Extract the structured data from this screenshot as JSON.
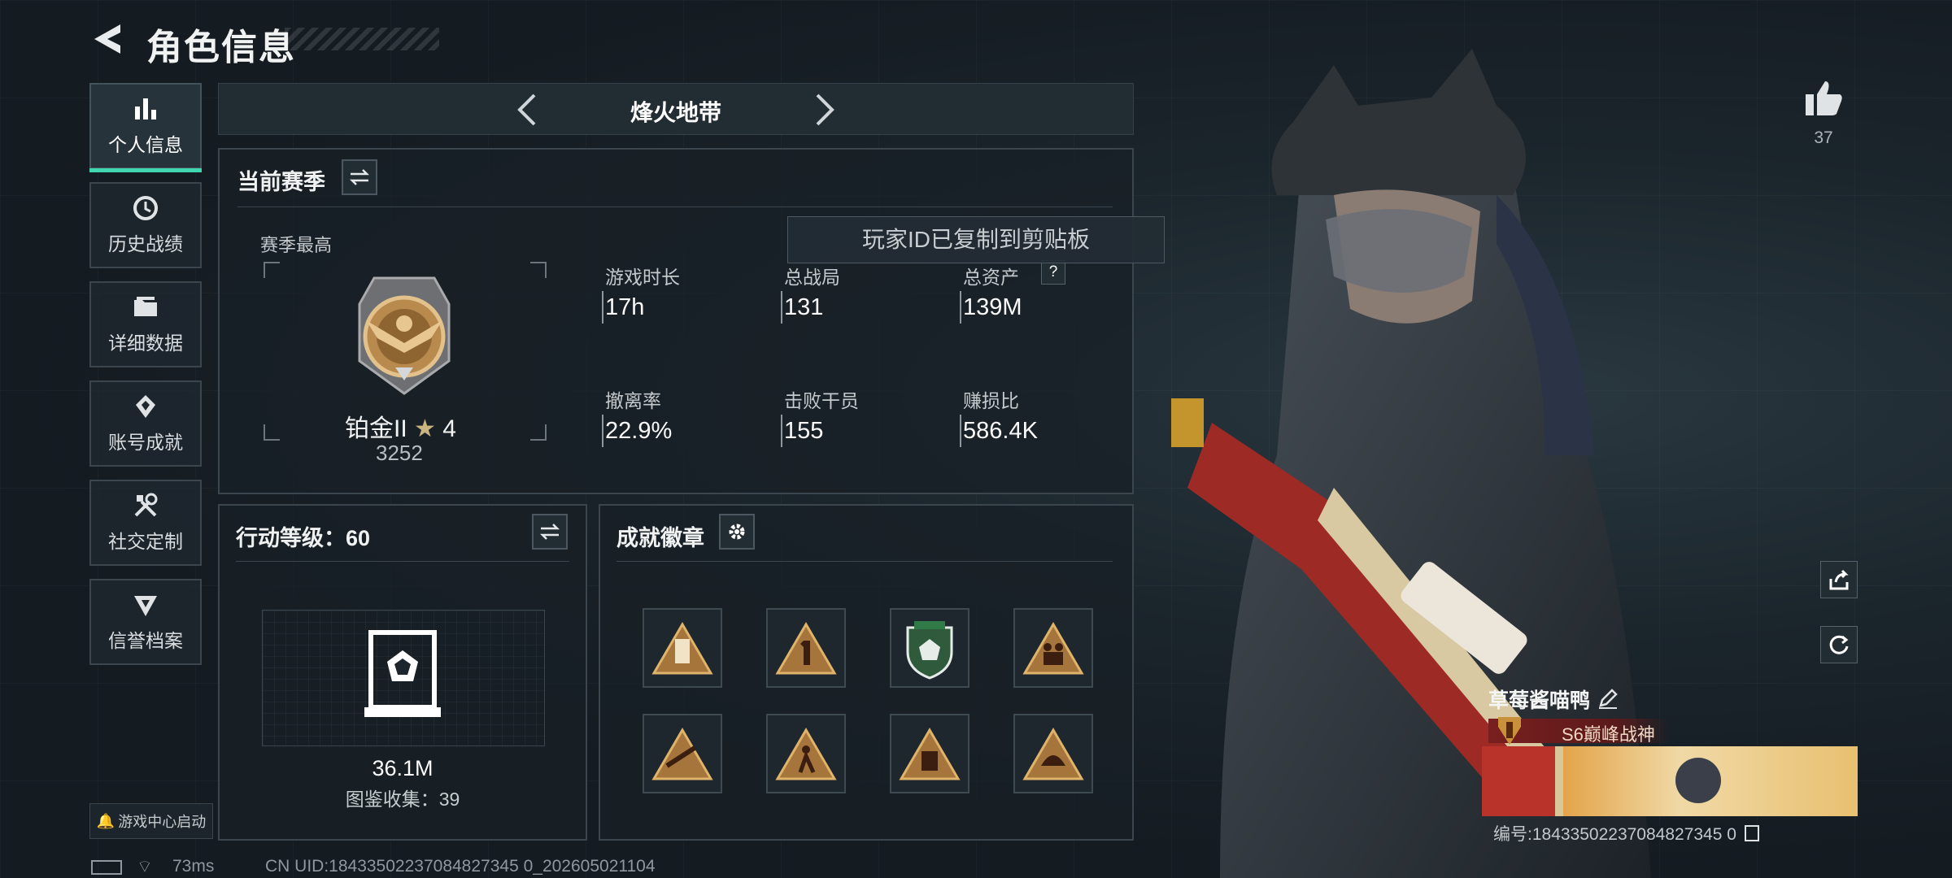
{
  "header": {
    "title": "角色信息"
  },
  "sidebar": {
    "items": [
      {
        "label": "个人信息",
        "icon": "bar-chart-icon",
        "active": true
      },
      {
        "label": "历史战绩",
        "icon": "history-icon"
      },
      {
        "label": "详细数据",
        "icon": "folder-icon"
      },
      {
        "label": "账号成就",
        "icon": "achievement-icon"
      },
      {
        "label": "社交定制",
        "icon": "tools-icon"
      },
      {
        "label": "信誉档案",
        "icon": "credit-icon"
      }
    ],
    "game_center": "游戏中心启动"
  },
  "mode": {
    "name": "烽火地带"
  },
  "season": {
    "title": "当前赛季",
    "best_label": "赛季最高",
    "rank": "铂金II",
    "stars": "4",
    "score": "3252",
    "stats": [
      {
        "label": "游戏时长",
        "value": "17h"
      },
      {
        "label": "总战局",
        "value": "131"
      },
      {
        "label": "总资产",
        "value": "139M",
        "help": "?"
      },
      {
        "label": "撤离率",
        "value": "22.9%"
      },
      {
        "label": "击败干员",
        "value": "155"
      },
      {
        "label": "赚损比",
        "value": "586.4K"
      }
    ]
  },
  "toast": "玩家ID已复制到剪贴板",
  "action_level": {
    "title": "行动等级：60",
    "value": "36.1M",
    "collection": "图鉴收集：39"
  },
  "achievements": {
    "title": "成就徽章"
  },
  "profile": {
    "likes": "37",
    "name": "草莓酱喵鸭",
    "tag": "S6巅峰战神",
    "uid": "编号:18433502237084827345 0"
  },
  "status_bar": {
    "ping": "73ms",
    "cn_uid": "CN UID:18433502237084827345 0_202605021104"
  },
  "colors": {
    "accent": "#3fd6b0",
    "tag_bg": "#6e1d1d"
  }
}
